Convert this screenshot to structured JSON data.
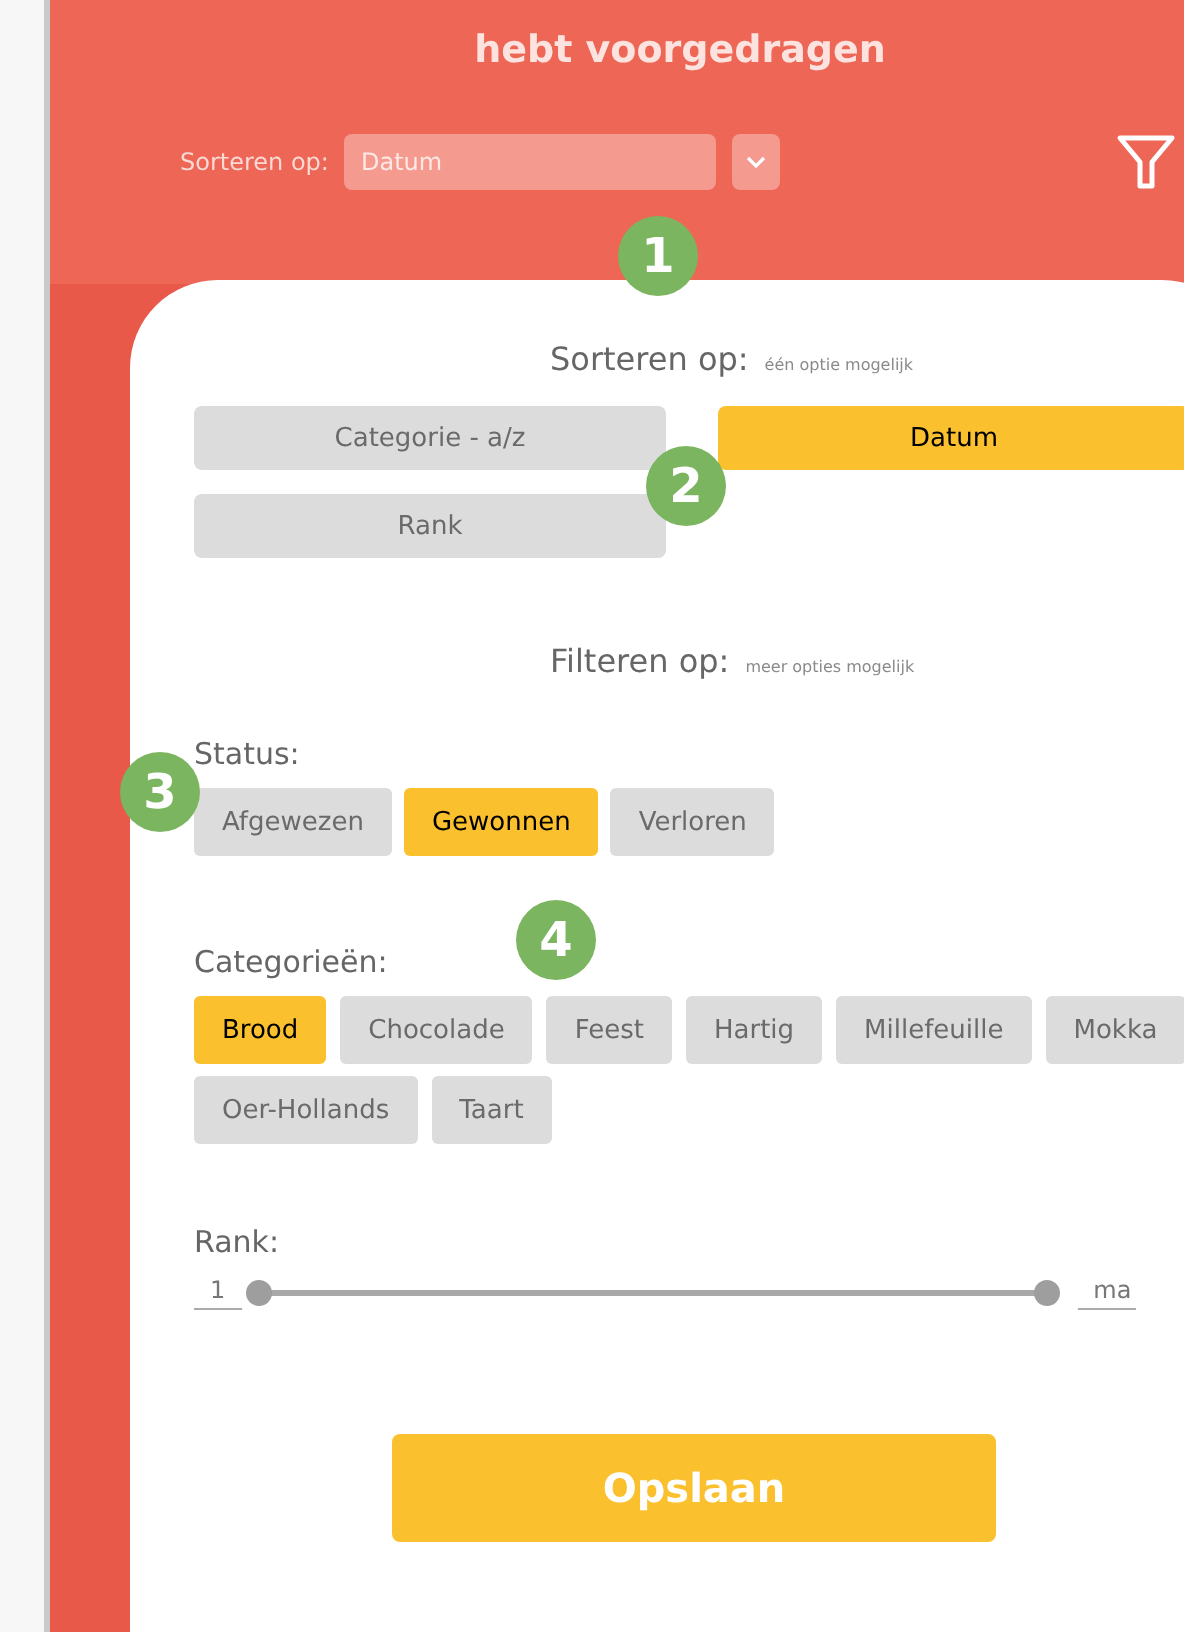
{
  "header": {
    "title": "hebt voorgedragen",
    "sort_label": "Sorteren op:",
    "sort_value": "Datum"
  },
  "badges": [
    "1",
    "2",
    "3",
    "4"
  ],
  "sort": {
    "title": "Sorteren op:",
    "hint": "één optie mogelijk",
    "options": [
      {
        "label": "Categorie - a/z",
        "selected": false
      },
      {
        "label": "Datum",
        "selected": true
      },
      {
        "label": "Rank",
        "selected": false
      }
    ]
  },
  "filter": {
    "title": "Filteren op:",
    "hint": "meer opties mogelijk"
  },
  "status": {
    "label": "Status:",
    "options": [
      {
        "label": "Afgewezen",
        "selected": false
      },
      {
        "label": "Gewonnen",
        "selected": true
      },
      {
        "label": "Verloren",
        "selected": false
      }
    ]
  },
  "categories": {
    "label": "Categorieën:",
    "options": [
      {
        "label": "Brood",
        "selected": true
      },
      {
        "label": "Chocolade",
        "selected": false
      },
      {
        "label": "Feest",
        "selected": false
      },
      {
        "label": "Hartig",
        "selected": false
      },
      {
        "label": "Millefeuille",
        "selected": false
      },
      {
        "label": "Mokka",
        "selected": false
      },
      {
        "label": "Oer-Hollands",
        "selected": false
      },
      {
        "label": "Taart",
        "selected": false
      }
    ]
  },
  "rank": {
    "label": "Rank:",
    "min": "1",
    "max": "ma",
    "low": {
      "level": 0
    },
    "high": {
      "level": 1
    }
  },
  "save": "Opslaan"
}
